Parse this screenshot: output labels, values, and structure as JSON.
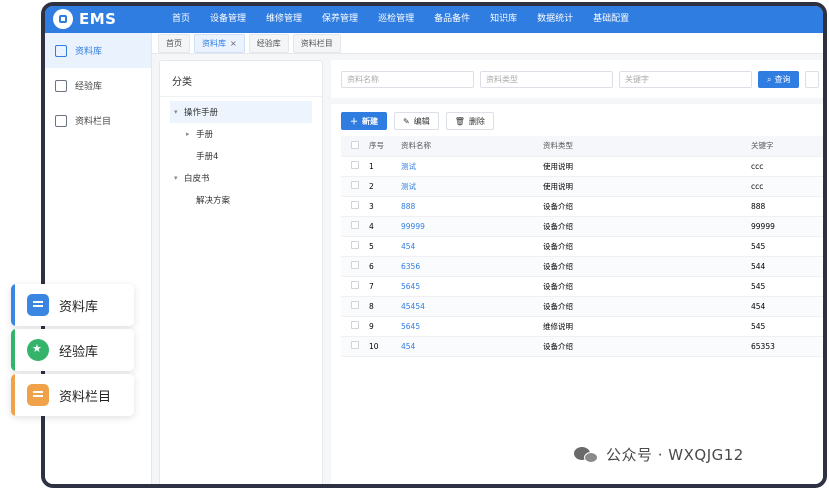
{
  "app": {
    "logo": "EMS"
  },
  "nav": [
    "首页",
    "设备管理",
    "维修管理",
    "保养管理",
    "巡检管理",
    "备品备件",
    "知识库",
    "数据统计",
    "基础配置"
  ],
  "sidebar": [
    {
      "label": "资料库",
      "active": true
    },
    {
      "label": "经验库",
      "active": false
    },
    {
      "label": "资料栏目",
      "active": false
    }
  ],
  "tabs": [
    {
      "label": "首页",
      "active": false
    },
    {
      "label": "资料库",
      "active": true,
      "close": "×"
    },
    {
      "label": "经验库",
      "active": false
    },
    {
      "label": "资料栏目",
      "active": false
    }
  ],
  "category": {
    "title": "分类",
    "tree": [
      {
        "label": "操作手册",
        "level": 0,
        "caret": "▾",
        "selected": true
      },
      {
        "label": "手册",
        "level": 1,
        "caret": "▸",
        "selected": false
      },
      {
        "label": "手册4",
        "level": 1,
        "caret": "",
        "selected": false
      },
      {
        "label": "白皮书",
        "level": 0,
        "caret": "▾",
        "selected": false
      },
      {
        "label": "解决方案",
        "level": 1,
        "caret": "",
        "selected": false
      }
    ]
  },
  "search": {
    "name_placeholder": "资料名称",
    "type_placeholder": "资料类型",
    "keyword_placeholder": "关键字",
    "query_label": "查询"
  },
  "toolbar": {
    "new_label": "新建",
    "edit_label": "编辑",
    "delete_label": "删除"
  },
  "table": {
    "headers": [
      "序号",
      "资料名称",
      "资料类型",
      "关键字"
    ],
    "rows": [
      [
        "1",
        "测试",
        "使用说明",
        "ccc"
      ],
      [
        "2",
        "测试",
        "使用说明",
        "ccc"
      ],
      [
        "3",
        "888",
        "设备介绍",
        "888"
      ],
      [
        "4",
        "99999",
        "设备介绍",
        "99999"
      ],
      [
        "5",
        "454",
        "设备介绍",
        "545"
      ],
      [
        "6",
        "6356",
        "设备介绍",
        "544"
      ],
      [
        "7",
        "5645",
        "设备介绍",
        "545"
      ],
      [
        "8",
        "45454",
        "设备介绍",
        "454"
      ],
      [
        "9",
        "5645",
        "维修说明",
        "545"
      ],
      [
        "10",
        "454",
        "设备介绍",
        "65353"
      ]
    ]
  },
  "float_cards": [
    {
      "label": "资料库",
      "color": "#3b86e0",
      "icon": "document-stack-icon"
    },
    {
      "label": "经验库",
      "color": "#34b36b",
      "icon": "star-badge-icon"
    },
    {
      "label": "资料栏目",
      "color": "#f0a24b",
      "icon": "folder-icon"
    }
  ],
  "watermark": {
    "text": "公众号 · WXQJG12"
  },
  "colors": {
    "primary": "#2f7de1",
    "frame": "#2d3142"
  }
}
